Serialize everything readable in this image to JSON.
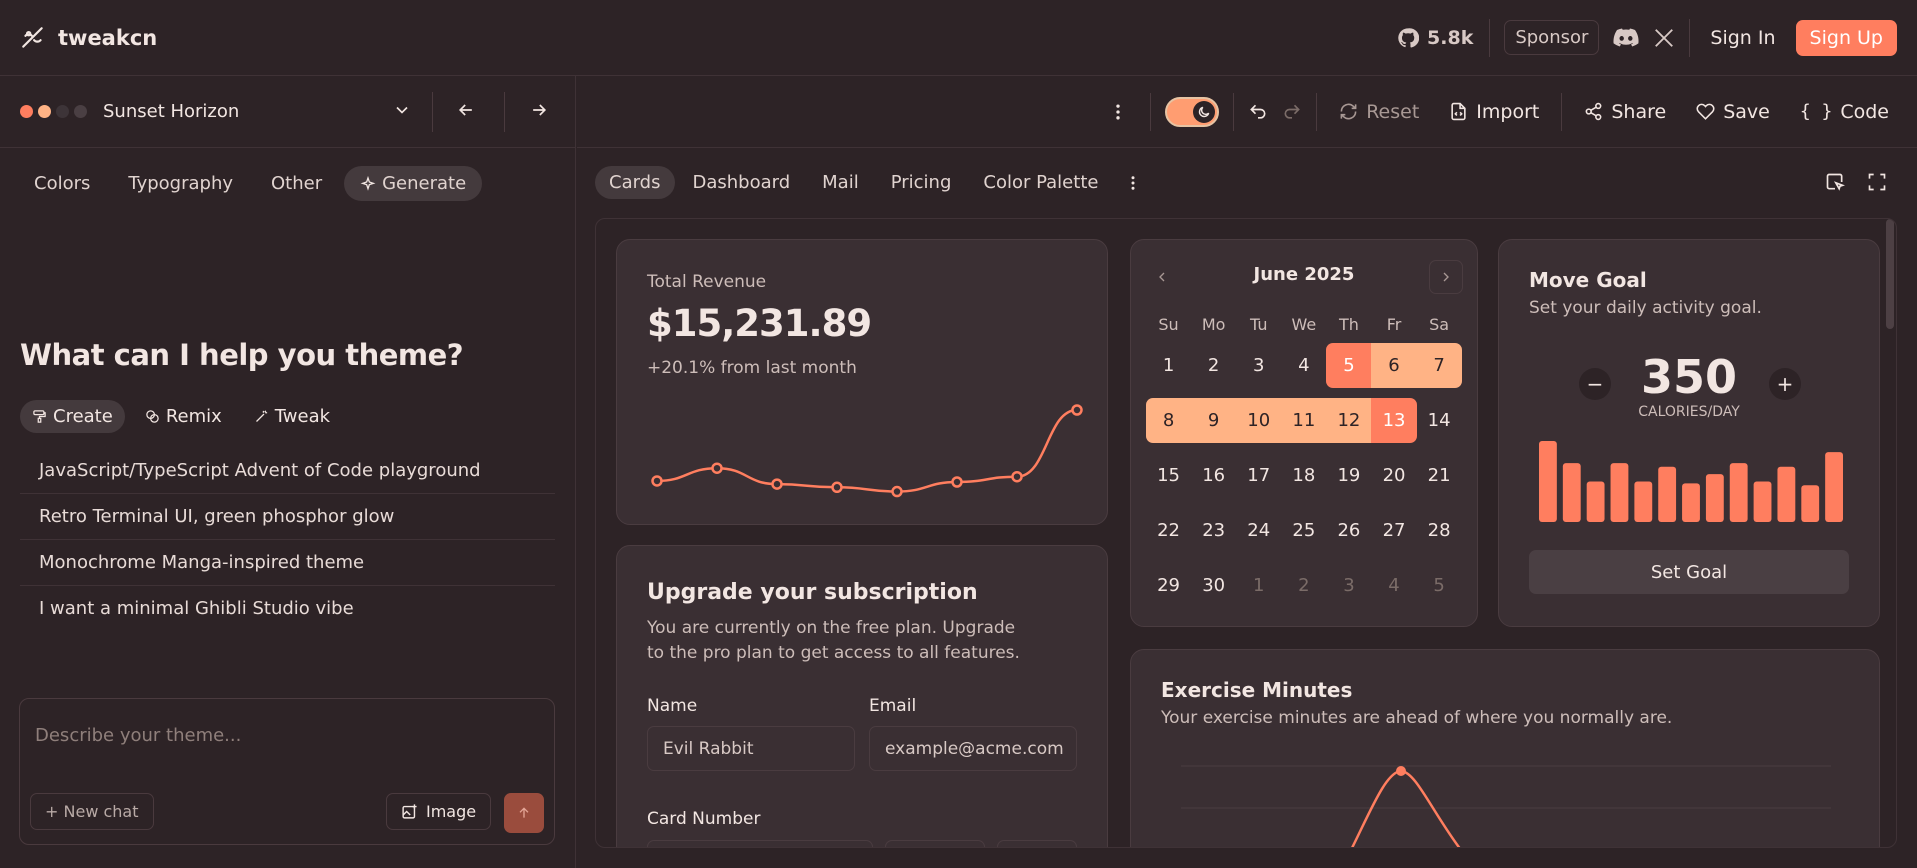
{
  "app": {
    "name": "tweakcn"
  },
  "header": {
    "github_stars": "5.8k",
    "sponsor_label": "Sponsor",
    "sign_in_label": "Sign In",
    "sign_up_label": "Sign Up"
  },
  "theme_bar": {
    "theme_name": "Sunset Horizon",
    "swatches": [
      "#ff7e5f",
      "#ffb385",
      "#3d3438",
      "#4a3f43"
    ]
  },
  "left_tabs": [
    "Colors",
    "Typography",
    "Other",
    "Generate"
  ],
  "left_active_tab": "Generate",
  "prompt_panel": {
    "heading": "What can I help you theme?",
    "modes": [
      "Create",
      "Remix",
      "Tweak"
    ],
    "suggestions": [
      "JavaScript/TypeScript Advent of Code playground",
      "Retro Terminal UI, green phosphor glow",
      "Monochrome Manga-inspired theme",
      "I want a minimal Ghibli Studio vibe"
    ],
    "placeholder": "Describe your theme...",
    "new_chat_label": "New chat",
    "image_label": "Image"
  },
  "toolbar": {
    "reset_label": "Reset",
    "import_label": "Import",
    "share_label": "Share",
    "save_label": "Save",
    "code_label": "Code"
  },
  "preview_tabs": [
    "Cards",
    "Dashboard",
    "Mail",
    "Pricing",
    "Color Palette"
  ],
  "preview_active_tab": "Cards",
  "revenue": {
    "title": "Total Revenue",
    "amount": "$15,231.89",
    "delta": "+20.1% from last month",
    "sparkline": [
      18,
      30,
      15,
      12,
      8,
      17,
      22,
      85
    ]
  },
  "calendar": {
    "month": "June 2025",
    "weekdays": [
      "Su",
      "Mo",
      "Tu",
      "We",
      "Th",
      "Fr",
      "Sa"
    ],
    "weeks": [
      [
        "1",
        "2",
        "3",
        "4",
        "5",
        "6",
        "7"
      ],
      [
        "8",
        "9",
        "10",
        "11",
        "12",
        "13",
        "14"
      ],
      [
        "15",
        "16",
        "17",
        "18",
        "19",
        "20",
        "21"
      ],
      [
        "22",
        "23",
        "24",
        "25",
        "26",
        "27",
        "28"
      ],
      [
        "29",
        "30",
        "1",
        "2",
        "3",
        "4",
        "5"
      ]
    ],
    "range_start": "5",
    "range_end": "13"
  },
  "move_goal": {
    "title": "Move Goal",
    "subtitle": "Set your daily activity goal.",
    "value": "350",
    "unit": "CALORIES/DAY",
    "button_label": "Set Goal",
    "bars": [
      88,
      64,
      44,
      64,
      44,
      60,
      42,
      52,
      64,
      44,
      60,
      40,
      76
    ]
  },
  "subscription": {
    "title": "Upgrade your subscription",
    "description_line1": "You are currently on the free plan. Upgrade",
    "description_line2": "to the pro plan to get access to all features.",
    "name_label": "Name",
    "name_value": "Evil Rabbit",
    "email_label": "Email",
    "email_placeholder": "example@acme.com",
    "card_label": "Card Number"
  },
  "exercise": {
    "title": "Exercise Minutes",
    "subtitle": "Your exercise minutes are ahead of where you normally are."
  },
  "colors": {
    "accent": "#ff7e5f",
    "accent_light": "#ffb385",
    "bg": "#2d2326",
    "card": "#3a2f33"
  }
}
